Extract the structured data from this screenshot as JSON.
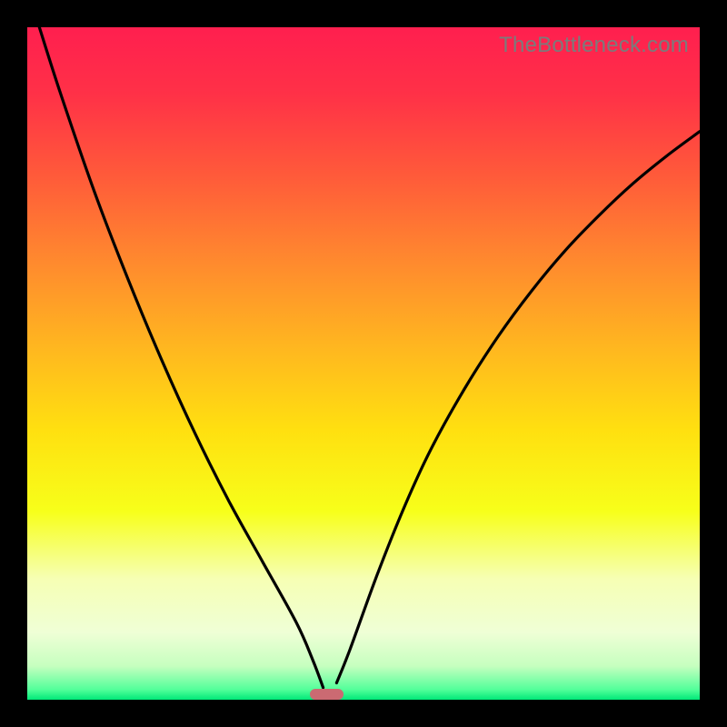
{
  "watermark": "TheBottleneck.com",
  "colors": {
    "frame": "#000000",
    "watermark": "#7b7b7b",
    "curve": "#000000",
    "marker": "#cb6a72",
    "gradient_stops": [
      {
        "offset": 0.0,
        "color": "#ff1f4f"
      },
      {
        "offset": 0.1,
        "color": "#ff3147"
      },
      {
        "offset": 0.22,
        "color": "#ff5a3a"
      },
      {
        "offset": 0.35,
        "color": "#ff8a2e"
      },
      {
        "offset": 0.48,
        "color": "#ffb81f"
      },
      {
        "offset": 0.6,
        "color": "#ffe010"
      },
      {
        "offset": 0.72,
        "color": "#f7ff1a"
      },
      {
        "offset": 0.82,
        "color": "#f6ffb4"
      },
      {
        "offset": 0.9,
        "color": "#efffd6"
      },
      {
        "offset": 0.95,
        "color": "#c6ffbf"
      },
      {
        "offset": 0.985,
        "color": "#52ff9a"
      },
      {
        "offset": 1.0,
        "color": "#00e878"
      }
    ]
  },
  "chart_data": {
    "type": "line",
    "title": "",
    "xlabel": "",
    "ylabel": "",
    "xlim": [
      0,
      1
    ],
    "ylim": [
      0,
      1
    ],
    "note": "V-shaped bottleneck curve. x is normalized hardware ratio; y is bottleneck penalty (0 at match). Minimum lies near x≈0.445. Watermark 'TheBottleneck.com' upper-right. Background is vertical red→green gradient.",
    "marker": {
      "x_center": 0.445,
      "width": 0.05,
      "height": 0.016
    },
    "series": [
      {
        "name": "left-branch",
        "x": [
          0.018,
          0.05,
          0.1,
          0.15,
          0.2,
          0.25,
          0.3,
          0.35,
          0.4,
          0.425,
          0.44
        ],
        "y": [
          1.0,
          0.9,
          0.755,
          0.625,
          0.505,
          0.395,
          0.295,
          0.205,
          0.115,
          0.058,
          0.018
        ]
      },
      {
        "name": "right-branch",
        "x": [
          0.46,
          0.48,
          0.52,
          0.56,
          0.6,
          0.65,
          0.7,
          0.75,
          0.8,
          0.85,
          0.9,
          0.95,
          1.0
        ],
        "y": [
          0.025,
          0.075,
          0.185,
          0.285,
          0.372,
          0.462,
          0.54,
          0.608,
          0.668,
          0.72,
          0.767,
          0.808,
          0.845
        ]
      }
    ]
  }
}
